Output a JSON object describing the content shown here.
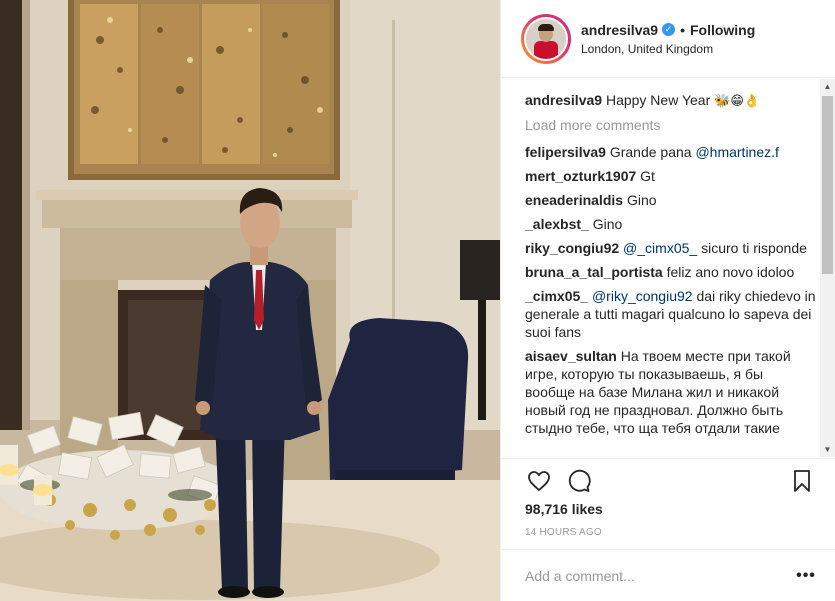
{
  "header": {
    "username": "andresilva9",
    "verified_icon": "verified-badge-icon",
    "separator": "•",
    "follow_state": "Following",
    "location": "London, United Kingdom"
  },
  "caption": {
    "user": "andresilva9",
    "text": "Happy New Year",
    "emoji": "🐝😁👌"
  },
  "load_more": "Load more comments",
  "comments": [
    {
      "user": "felipersilva9",
      "pre": "Grande pana",
      "mention": "@hmartinez.f",
      "post": ""
    },
    {
      "user": "mert_ozturk1907",
      "pre": "Gt",
      "mention": "",
      "post": ""
    },
    {
      "user": "eneaderinaldis",
      "pre": "Gino",
      "mention": "",
      "post": ""
    },
    {
      "user": "_alexbst_",
      "pre": "Gino",
      "mention": "",
      "post": ""
    },
    {
      "user": "riky_congiu92",
      "pre": "",
      "mention": "@_cimx05_",
      "post": "sicuro ti risponde"
    },
    {
      "user": "bruna_a_tal_portista",
      "pre": "feliz ano novo idoloo",
      "mention": "",
      "post": ""
    },
    {
      "user": "_cimx05_",
      "pre": "",
      "mention": "@riky_congiu92",
      "post": "dai riky chiedevo in generale a tutti magari qualcuno lo sapeva dei suoi fans"
    },
    {
      "user": "aisaev_sultan",
      "pre": "На твоем месте при такой игре, которую ты показываешь, я бы вообще на базе Милана жил и никакой новый год не праздновал. Должно быть стыдно тебе, что ща тебя отдали такие",
      "mention": "",
      "post": ""
    }
  ],
  "actions": {
    "like_icon": "heart-icon",
    "comment_icon": "comment-bubble-icon",
    "save_icon": "bookmark-icon"
  },
  "likes": "98,716 likes",
  "timestamp": "14 HOURS AGO",
  "add_comment": {
    "placeholder": "Add a comment...",
    "more_label": "•••"
  },
  "scrollbar": {
    "up_icon": "▲",
    "down_icon": "▼"
  }
}
